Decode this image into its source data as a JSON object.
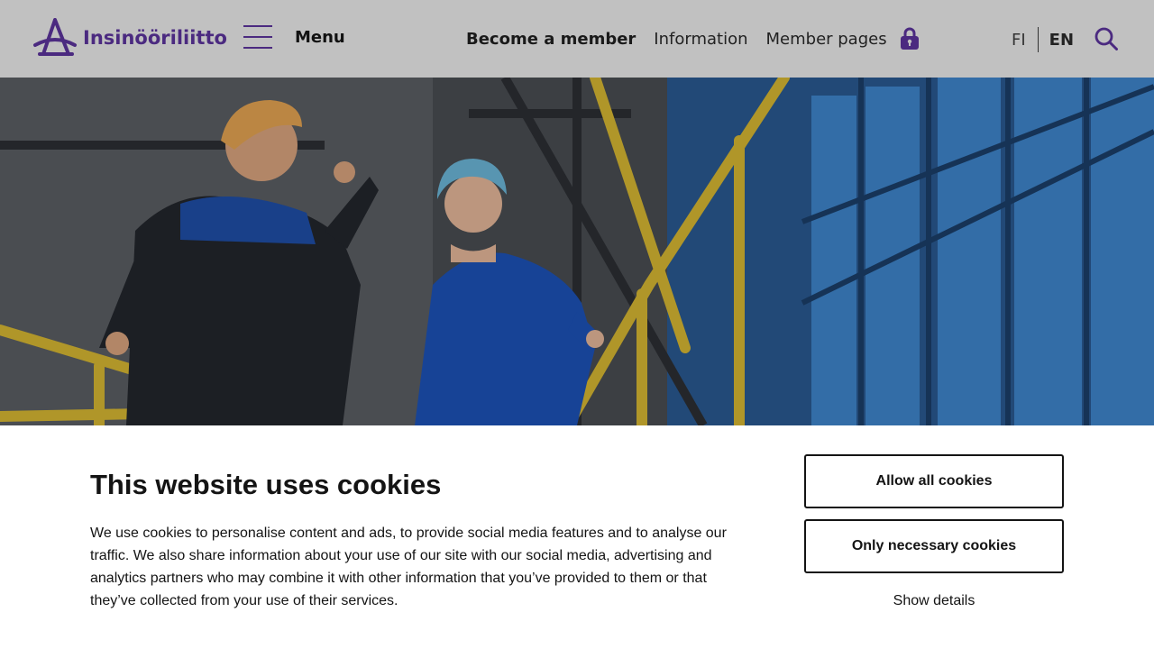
{
  "header": {
    "logo_text": "Insinööriliitto",
    "menu_label": "Menu",
    "nav": {
      "become_member": "Become a member",
      "information": "Information",
      "member_pages": "Member pages"
    },
    "lang": {
      "fi": "FI",
      "en": "EN",
      "active": "EN"
    },
    "icons": {
      "menu": "hamburger-icon",
      "lock": "lock-icon",
      "search": "search-icon",
      "logo": "logo-icon"
    }
  },
  "hero": {
    "image": "industrial-workers-photo"
  },
  "cookie_banner": {
    "title": "This website uses cookies",
    "body": "We use cookies to personalise content and ads, to provide social media features and to analyse our traffic. We also share information about your use of our site with our social media, advertising and analytics partners who may combine it with other information that you’ve provided to them or that they’ve collected from your use of their services.",
    "allow_all": "Allow all cookies",
    "only_necessary": "Only necessary cookies",
    "show_details": "Show details"
  },
  "colors": {
    "brand": "#4b2a80",
    "header_bg": "#c1c1c1",
    "text": "#141414"
  }
}
